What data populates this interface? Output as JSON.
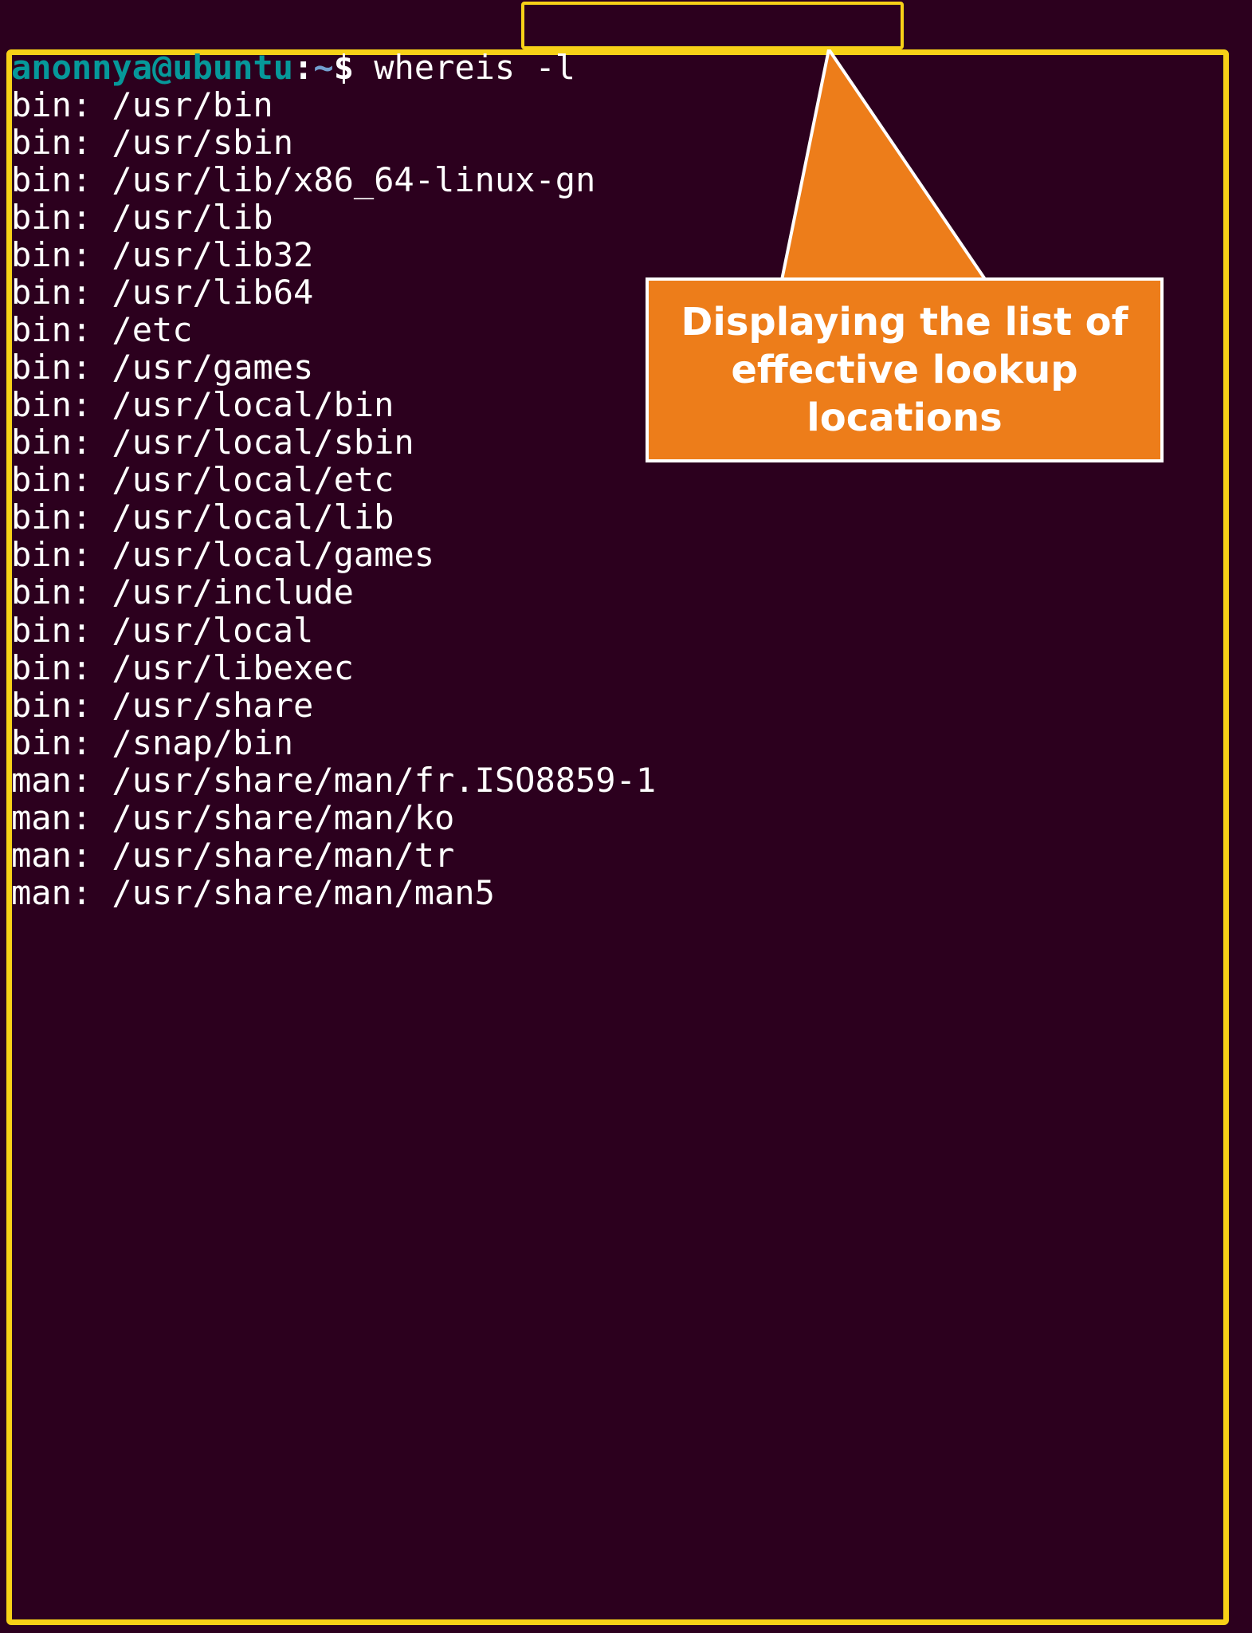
{
  "prompt": {
    "user": "anonnya",
    "at": "@",
    "host": "ubuntu",
    "sep": ":",
    "path": "~",
    "dollar": "$",
    "command": "whereis -l"
  },
  "output_lines": [
    "bin: /usr/bin",
    "bin: /usr/sbin",
    "bin: /usr/lib/x86_64-linux-gn",
    "bin: /usr/lib",
    "bin: /usr/lib32",
    "bin: /usr/lib64",
    "bin: /etc",
    "bin: /usr/games",
    "bin: /usr/local/bin",
    "bin: /usr/local/sbin",
    "bin: /usr/local/etc",
    "bin: /usr/local/lib",
    "bin: /usr/local/games",
    "bin: /usr/include",
    "bin: /usr/local",
    "bin: /usr/libexec",
    "bin: /usr/share",
    "bin: /snap/bin",
    "man: /usr/share/man/fr.ISO8859-1",
    "man: /usr/share/man/ko",
    "man: /usr/share/man/tr",
    "man: /usr/share/man/man5"
  ],
  "callout": {
    "text": "Displaying the list of effective lookup locations"
  },
  "colors": {
    "background": "#2c001e",
    "highlight": "#f7d117",
    "callout_bg": "#ed7d1a",
    "prompt_userhost": "#06989a",
    "prompt_path": "#729fcf"
  }
}
